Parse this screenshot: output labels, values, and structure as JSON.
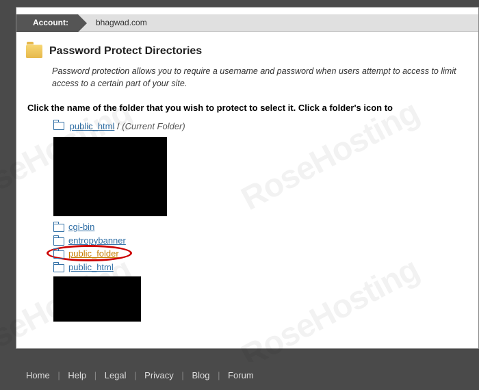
{
  "account": {
    "label": "Account:",
    "domain": "bhagwad.com"
  },
  "page": {
    "title": "Password Protect Directories",
    "intro": "Password protection allows you to require a username and password when users attempt to access to limit access to a certain part of your site.",
    "instruction": "Click the name of the folder that you wish to protect to select it. Click a folder's icon to"
  },
  "breadcrumb": {
    "root": "public_html",
    "current_label": "(Current Folder)"
  },
  "folders": [
    {
      "name": "cgi-bin",
      "highlighted": false
    },
    {
      "name": "entropybanner",
      "highlighted": false
    },
    {
      "name": "public_folder",
      "highlighted": true
    },
    {
      "name": "public_html",
      "highlighted": false
    }
  ],
  "footer": {
    "links": [
      "Home",
      "Help",
      "Legal",
      "Privacy",
      "Blog",
      "Forum"
    ]
  },
  "watermark": "RoseHosting"
}
